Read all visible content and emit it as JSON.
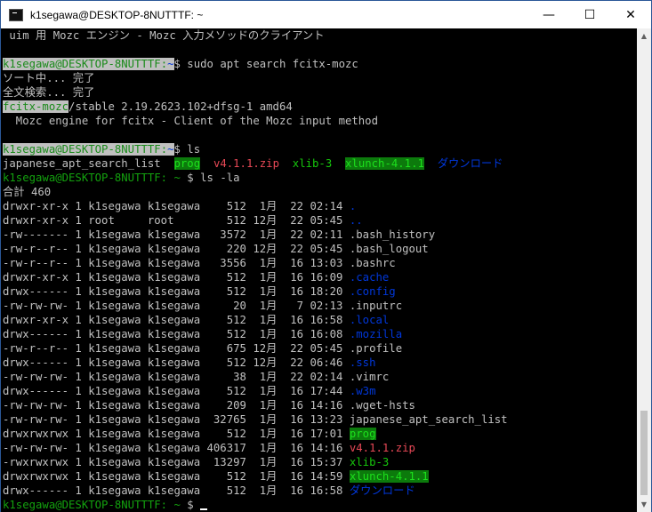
{
  "window": {
    "title": "k1segawa@DESKTOP-8NUTTTF: ~",
    "controls": {
      "minimize": "—",
      "maximize": "☐",
      "close": "✕"
    }
  },
  "terminal": {
    "line1": " uim 用 Mozc エンジン - Mozc 入力メソッドのクライアント",
    "prompt_user": "k1segawa@DESKTOP-8NUTTTF",
    "prompt_sep": ":",
    "prompt_dir": "~",
    "cmd1": "$ sudo apt search fcitx-mozc",
    "sort": "ソート中... 完了",
    "fulltext": "全文検索... 完了",
    "pkg_name": "fcitx-mozc",
    "pkg_rest": "/stable 2.19.2623.102+dfsg-1 amd64",
    "pkg_desc": "  Mozc engine for fcitx - Client of the Mozc input method",
    "cmd2": "$ ls",
    "ls_entries": [
      "japanese_apt_search_list",
      "prog",
      "v4.1.1.zip",
      "xlib-3",
      "xlunch-4.1.1",
      "ダウンロード"
    ],
    "cmd3_prompt": "k1segawa@DESKTOP-8NUTTTF: ~",
    "cmd3": "$ ls -la",
    "total": "合計 460",
    "rows": [
      {
        "meta": "drwxr-xr-x 1 k1segawa k1segawa    512  1月  22 02:14 ",
        "name": "."
      },
      {
        "meta": "drwxr-xr-x 1 root     root        512 12月  22 05:45 ",
        "name": ".."
      },
      {
        "meta": "-rw------- 1 k1segawa k1segawa   3572  1月  22 02:11 ",
        "name": ".bash_history"
      },
      {
        "meta": "-rw-r--r-- 1 k1segawa k1segawa    220 12月  22 05:45 ",
        "name": ".bash_logout"
      },
      {
        "meta": "-rw-r--r-- 1 k1segawa k1segawa   3556  1月  16 13:03 ",
        "name": ".bashrc"
      },
      {
        "meta": "drwxr-xr-x 1 k1segawa k1segawa    512  1月  16 16:09 ",
        "name": ".cache"
      },
      {
        "meta": "drwx------ 1 k1segawa k1segawa    512  1月  16 18:20 ",
        "name": ".config"
      },
      {
        "meta": "-rw-rw-rw- 1 k1segawa k1segawa     20  1月   7 02:13 ",
        "name": ".inputrc"
      },
      {
        "meta": "drwxr-xr-x 1 k1segawa k1segawa    512  1月  16 16:58 ",
        "name": ".local"
      },
      {
        "meta": "drwx------ 1 k1segawa k1segawa    512  1月  16 16:08 ",
        "name": ".mozilla"
      },
      {
        "meta": "-rw-r--r-- 1 k1segawa k1segawa    675 12月  22 05:45 ",
        "name": ".profile"
      },
      {
        "meta": "drwx------ 1 k1segawa k1segawa    512 12月  22 06:46 ",
        "name": ".ssh"
      },
      {
        "meta": "-rw-rw-rw- 1 k1segawa k1segawa     38  1月  22 02:14 ",
        "name": ".vimrc"
      },
      {
        "meta": "drwx------ 1 k1segawa k1segawa    512  1月  16 17:44 ",
        "name": ".w3m"
      },
      {
        "meta": "-rw-rw-rw- 1 k1segawa k1segawa    209  1月  16 14:16 ",
        "name": ".wget-hsts"
      },
      {
        "meta": "-rw-rw-rw- 1 k1segawa k1segawa  32765  1月  16 13:23 ",
        "name": "japanese_apt_search_list"
      },
      {
        "meta": "drwxrwxrwx 1 k1segawa k1segawa    512  1月  16 17:01 ",
        "name": "prog"
      },
      {
        "meta": "-rw-rw-rw- 1 k1segawa k1segawa 406317  1月  16 14:16 ",
        "name": "v4.1.1.zip"
      },
      {
        "meta": "-rwxrwxrwx 1 k1segawa k1segawa  13297  1月  16 15:37 ",
        "name": "xlib-3"
      },
      {
        "meta": "drwxrwxrwx 1 k1segawa k1segawa    512  1月  16 14:59 ",
        "name": "xlunch-4.1.1"
      },
      {
        "meta": "drwx------ 1 k1segawa k1segawa    512  1月  16 16:58 ",
        "name": "ダウンロード"
      }
    ],
    "final_prompt": "k1segawa@DESKTOP-8NUTTTF: ~",
    "final_cmd": "$ "
  },
  "colors": {
    "background": "#000000",
    "text": "#c0c0c0",
    "prompt_green": "#13a10e",
    "dir_blue": "#0037da",
    "zip_red": "#e74856",
    "exec_green": "#16c60c"
  },
  "scrollbar": {
    "up_icon": "▲",
    "down_icon": "▼"
  }
}
